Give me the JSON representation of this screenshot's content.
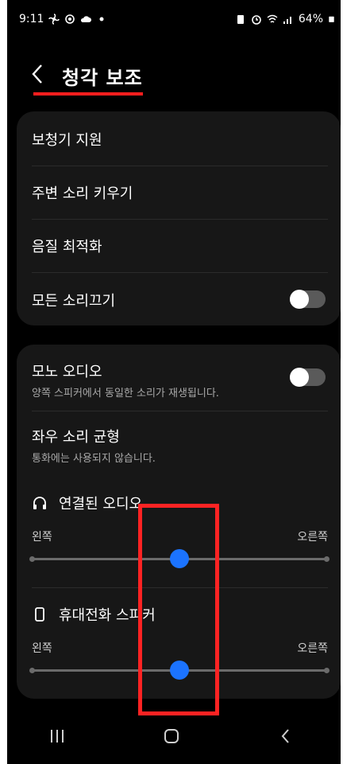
{
  "status": {
    "time": "9:11",
    "battery": "64%"
  },
  "header": {
    "title": "청각 보조"
  },
  "card1": {
    "items": [
      {
        "label": "보청기 지원"
      },
      {
        "label": "주변 소리 키우기"
      },
      {
        "label": "음질 최적화"
      },
      {
        "label": "모든 소리끄기",
        "toggle": false
      }
    ]
  },
  "card2": {
    "mono": {
      "label": "모노 오디오",
      "sub": "양쪽 스피커에서 동일한 소리가 재생됩니다.",
      "toggle": false
    },
    "balance": {
      "label": "좌우 소리 균형",
      "sub": "통화에는 사용되지 않습니다."
    },
    "connected_audio": {
      "label": "연결된 오디오",
      "left": "왼쪽",
      "right": "오른쪽",
      "value": 0.5
    },
    "phone_speaker": {
      "label": "휴대전화 스피커",
      "left": "왼쪽",
      "right": "오른쪽",
      "value": 0.5
    }
  },
  "colors": {
    "accent": "#1b73ff",
    "highlight": "#ff2323"
  },
  "icons": [
    "fan-icon",
    "sync-icon",
    "cloud-icon",
    "dot-icon",
    "lock-battery-icon",
    "alarm-icon",
    "wifi-icon",
    "signal-icon",
    "battery-icon",
    "back-chevron-icon",
    "headphones-icon",
    "phone-icon",
    "recent-apps-icon",
    "home-icon",
    "nav-back-icon"
  ]
}
